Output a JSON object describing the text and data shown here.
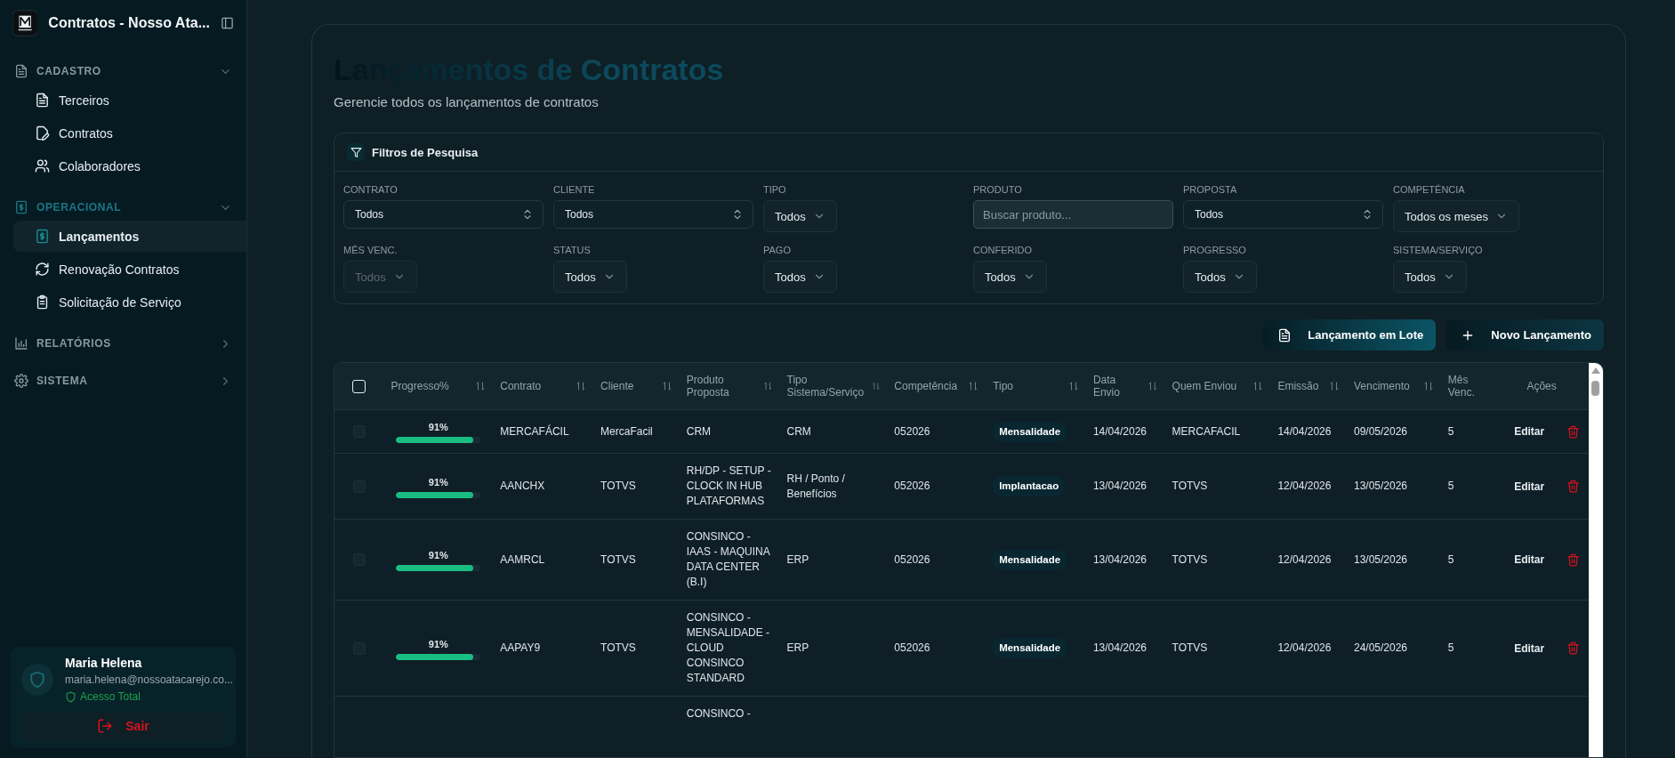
{
  "sidebar": {
    "app_title": "Contratos - Nosso Ata...",
    "sections": [
      {
        "label": "CADASTRO",
        "expanded": true,
        "active": false,
        "items": [
          {
            "label": "Terceiros",
            "selected": false
          },
          {
            "label": "Contratos",
            "selected": false
          },
          {
            "label": "Colaboradores",
            "selected": false
          }
        ]
      },
      {
        "label": "OPERACIONAL",
        "expanded": true,
        "active": true,
        "items": [
          {
            "label": "Lançamentos",
            "selected": true
          },
          {
            "label": "Renovação Contratos",
            "selected": false
          },
          {
            "label": "Solicitação de Serviço",
            "selected": false
          }
        ]
      },
      {
        "label": "RELATÓRIOS",
        "expanded": false,
        "active": false
      },
      {
        "label": "SISTEMA",
        "expanded": false,
        "active": false
      }
    ],
    "user": {
      "name": "Maria Helena",
      "email": "maria.helena@nossoatacarejo.co...",
      "access": "Acesso Total",
      "logout": "Sair"
    }
  },
  "page": {
    "title": "Lançamentos de Contratos",
    "subtitle": "Gerencie todos os lançamentos de contratos"
  },
  "filters": {
    "title": "Filtros de Pesquisa",
    "fields": [
      {
        "label": "CONTRATO",
        "kind": "combo",
        "value": "Todos",
        "disabled": false
      },
      {
        "label": "CLIENTE",
        "kind": "combo",
        "value": "Todos",
        "disabled": false
      },
      {
        "label": "TIPO",
        "kind": "select",
        "value": "Todos",
        "disabled": false
      },
      {
        "label": "PRODUTO",
        "kind": "search",
        "placeholder": "Buscar produto...",
        "disabled": false
      },
      {
        "label": "PROPOSTA",
        "kind": "combo",
        "value": "Todos",
        "disabled": false
      },
      {
        "label": "COMPETÊNCIA",
        "kind": "select",
        "value": "Todos os meses",
        "disabled": false
      },
      {
        "label": "MÊS VENC.",
        "kind": "select",
        "value": "Todos",
        "disabled": true
      },
      {
        "label": "STATUS",
        "kind": "select",
        "value": "Todos",
        "disabled": false
      },
      {
        "label": "PAGO",
        "kind": "select",
        "value": "Todos",
        "disabled": false
      },
      {
        "label": "CONFERIDO",
        "kind": "select",
        "value": "Todos",
        "disabled": false
      },
      {
        "label": "PROGRESSO",
        "kind": "select",
        "value": "Todos",
        "disabled": false
      },
      {
        "label": "SISTEMA/SERVIÇO",
        "kind": "select",
        "value": "Todos",
        "disabled": false
      }
    ]
  },
  "actions": [
    {
      "label": "Lançamento em Lote",
      "kind": "batch"
    },
    {
      "label": "Novo Lançamento",
      "kind": "new"
    }
  ],
  "table": {
    "select_all": {
      "checked": false
    },
    "columns": [
      {
        "label": "Progresso%",
        "sortable": true
      },
      {
        "label": "Contrato",
        "sortable": true
      },
      {
        "label": "Cliente",
        "sortable": true
      },
      {
        "label": "Produto Proposta",
        "sortable": true
      },
      {
        "label": "Tipo Sistema/Serviço",
        "sortable": true
      },
      {
        "label": "Competência",
        "sortable": true
      },
      {
        "label": "Tipo",
        "sortable": true
      },
      {
        "label": "Data Envio",
        "sortable": true
      },
      {
        "label": "Quem Enviou",
        "sortable": true
      },
      {
        "label": "Emissão",
        "sortable": true
      },
      {
        "label": "Vencimento",
        "sortable": true
      },
      {
        "label": "Mês Venc.",
        "sortable": false
      },
      {
        "label": "Ações",
        "sortable": false
      }
    ],
    "rows": [
      {
        "checked": false,
        "progress": {
          "level": 0.91,
          "reading": "91%"
        },
        "contrato": "MERCAFÁCIL",
        "cliente": "MercaFacil",
        "produto": "CRM",
        "sistema": "CRM",
        "competencia": "052026",
        "tipo": "Mensalidade",
        "data_envio": "14/04/2026",
        "quem_enviou": "MERCAFACIL",
        "emissao": "14/04/2026",
        "vencimento": "09/05/2026",
        "mes_venc": "5",
        "action": "Editar"
      },
      {
        "checked": false,
        "progress": {
          "level": 0.91,
          "reading": "91%"
        },
        "contrato": "AANCHX",
        "cliente": "TOTVS",
        "produto": "RH/DP - SETUP - CLOCK IN HUB PLATAFORMAS",
        "sistema": "RH / Ponto / Benefícios",
        "competencia": "052026",
        "tipo": "Implantacao",
        "data_envio": "13/04/2026",
        "quem_enviou": "TOTVS",
        "emissao": "12/04/2026",
        "vencimento": "13/05/2026",
        "mes_venc": "5",
        "action": "Editar"
      },
      {
        "checked": false,
        "progress": {
          "level": 0.91,
          "reading": "91%"
        },
        "contrato": "AAMRCL",
        "cliente": "TOTVS",
        "produto": "CONSINCO - IAAS - MAQUINA DATA CENTER (B.I)",
        "sistema": "ERP",
        "competencia": "052026",
        "tipo": "Mensalidade",
        "data_envio": "13/04/2026",
        "quem_enviou": "TOTVS",
        "emissao": "12/04/2026",
        "vencimento": "13/05/2026",
        "mes_venc": "5",
        "action": "Editar"
      },
      {
        "checked": false,
        "progress": {
          "level": 0.91,
          "reading": "91%"
        },
        "contrato": "AAPAY9",
        "cliente": "TOTVS",
        "produto": "CONSINCO - MENSALIDADE - CLOUD CONSINCO STANDARD",
        "sistema": "ERP",
        "competencia": "052026",
        "tipo": "Mensalidade",
        "data_envio": "13/04/2026",
        "quem_enviou": "TOTVS",
        "emissao": "12/04/2026",
        "vencimento": "24/05/2026",
        "mes_venc": "5",
        "action": "Editar"
      },
      {
        "produto": "CONSINCO -"
      }
    ]
  }
}
